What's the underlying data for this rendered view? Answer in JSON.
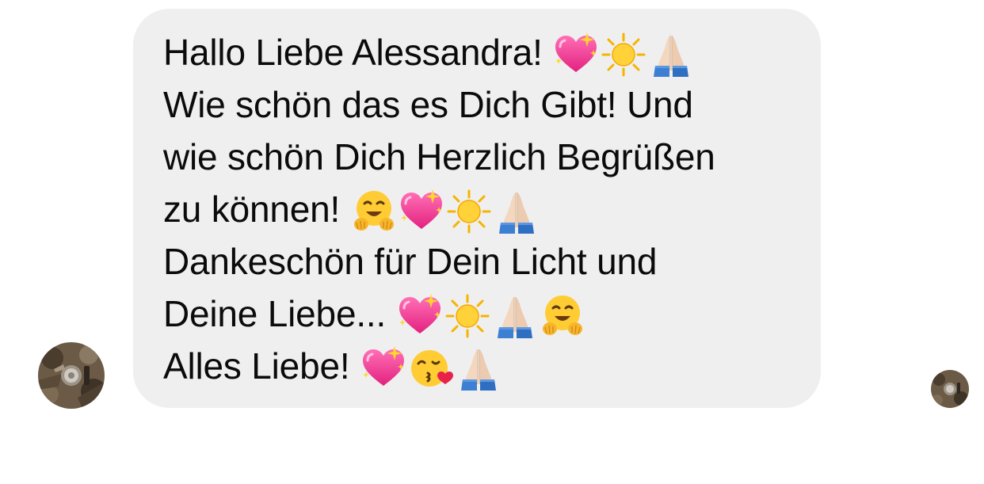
{
  "conversation": {
    "sender_avatar": "avatar-photo",
    "read_receipt_avatar": "avatar-photo",
    "message": {
      "lines": [
        {
          "text": "Hallo Liebe Alessandra! ",
          "emojis": [
            "sparkling-heart",
            "sun",
            "folded-hands"
          ]
        },
        {
          "text": "Wie schön das es Dich Gibt! Und",
          "emojis": []
        },
        {
          "text": "wie schön Dich Herzlich Begrüßen",
          "emojis": []
        },
        {
          "text": "zu können! ",
          "emojis": [
            "hugging-face",
            "sparkling-heart",
            "sun",
            "folded-hands"
          ]
        },
        {
          "text": "Dankeschön für Dein Licht und",
          "emojis": []
        },
        {
          "text": "Deine Liebe... ",
          "emojis": [
            "sparkling-heart",
            "sun",
            "folded-hands",
            "hugging-face"
          ]
        },
        {
          "text": "Alles Liebe! ",
          "emojis": [
            "sparkling-heart",
            "face-blowing-kiss",
            "folded-hands"
          ]
        }
      ]
    }
  },
  "colors": {
    "bubble_background": "#efeff0",
    "text": "#0b0b0b",
    "page_background": "#ffffff"
  }
}
